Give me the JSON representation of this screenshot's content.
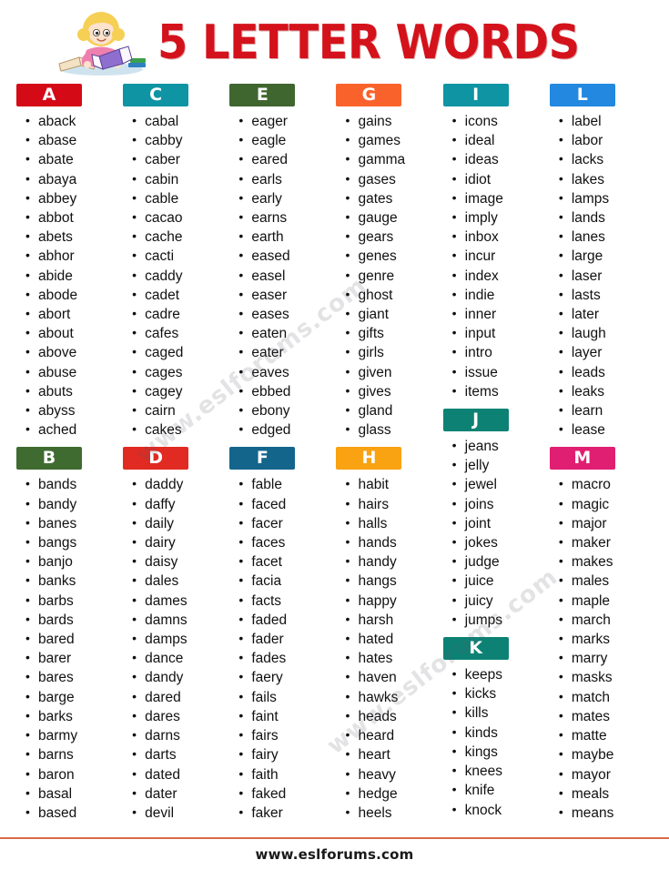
{
  "header": {
    "title": "5 LETTER WORDS",
    "mascot_icon": "girl-reading-book-illustration",
    "title_color": "#d4121b"
  },
  "watermark": {
    "text": "www.eslforums.com"
  },
  "footer": {
    "site": "www.eslforums.com",
    "rule_color": "#d76a4a"
  },
  "columns": [
    {
      "sections": [
        {
          "letter": "A",
          "color": "#d40a16",
          "words": [
            "aback",
            "abase",
            "abate",
            "abaya",
            "abbey",
            "abbot",
            "abets",
            "abhor",
            "abide",
            "abode",
            "abort",
            "about",
            "above",
            "abuse",
            "abuts",
            "abyss",
            "ached"
          ]
        },
        {
          "letter": "B",
          "color": "#3f6b31",
          "words": [
            "bands",
            "bandy",
            "banes",
            "bangs",
            "banjo",
            "banks",
            "barbs",
            "bards",
            "bared",
            "barer",
            "bares",
            "barge",
            "barks",
            "barmy",
            "barns",
            "baron",
            "basal",
            "based"
          ]
        }
      ]
    },
    {
      "sections": [
        {
          "letter": "C",
          "color": "#0f94a3",
          "words": [
            "cabal",
            "cabby",
            "caber",
            "cabin",
            "cable",
            "cacao",
            "cache",
            "cacti",
            "caddy",
            "cadet",
            "cadre",
            "cafes",
            "caged",
            "cages",
            "cagey",
            "cairn",
            "cakes"
          ]
        },
        {
          "letter": "D",
          "color": "#e12a21",
          "words": [
            "daddy",
            "daffy",
            "daily",
            "dairy",
            "daisy",
            "dales",
            "dames",
            "damns",
            "damps",
            "dance",
            "dandy",
            "dared",
            "dares",
            "darns",
            "darts",
            "dated",
            "dater",
            "devil"
          ]
        }
      ]
    },
    {
      "sections": [
        {
          "letter": "E",
          "color": "#40662f",
          "words": [
            "eager",
            "eagle",
            "eared",
            "earls",
            "early",
            "earns",
            "earth",
            "eased",
            "easel",
            "easer",
            "eases",
            "eaten",
            "eater",
            "eaves",
            "ebbed",
            "ebony",
            "edged"
          ]
        },
        {
          "letter": "F",
          "color": "#13658c",
          "words": [
            "fable",
            "faced",
            "facer",
            "faces",
            "facet",
            "facia",
            "facts",
            "faded",
            "fader",
            "fades",
            "faery",
            "fails",
            "faint",
            "fairs",
            "fairy",
            "faith",
            "faked",
            "faker"
          ]
        }
      ]
    },
    {
      "sections": [
        {
          "letter": "G",
          "color": "#f9632b",
          "words": [
            "gains",
            "games",
            "gamma",
            "gases",
            "gates",
            "gauge",
            "gears",
            "genes",
            "genre",
            "ghost",
            "giant",
            "gifts",
            "girls",
            "given",
            "gives",
            "gland",
            "glass"
          ]
        },
        {
          "letter": "H",
          "color": "#f9a212",
          "words": [
            "habit",
            "hairs",
            "halls",
            "hands",
            "handy",
            "hangs",
            "happy",
            "harsh",
            "hated",
            "hates",
            "haven",
            "hawks",
            "heads",
            "heard",
            "heart",
            "heavy",
            "hedge",
            "heels"
          ]
        }
      ]
    },
    {
      "sections": [
        {
          "letter": "I",
          "color": "#0f94a3",
          "words": [
            "icons",
            "ideal",
            "ideas",
            "idiot",
            "image",
            "imply",
            "inbox",
            "incur",
            "index",
            "indie",
            "inner",
            "input",
            "intro",
            "issue",
            "items"
          ]
        },
        {
          "letter": "J",
          "color": "#0d8274",
          "words": [
            "jeans",
            "jelly",
            "jewel",
            "joins",
            "joint",
            "jokes",
            "judge",
            "juice",
            "juicy",
            "jumps"
          ]
        },
        {
          "letter": "K",
          "color": "#0d8274",
          "words": [
            "keeps",
            "kicks",
            "kills",
            "kinds",
            "kings",
            "knees",
            "knife",
            "knock"
          ]
        }
      ]
    },
    {
      "sections": [
        {
          "letter": "L",
          "color": "#2288e0",
          "words": [
            "label",
            "labor",
            "lacks",
            "lakes",
            "lamps",
            "lands",
            "lanes",
            "large",
            "laser",
            "lasts",
            "later",
            "laugh",
            "layer",
            "leads",
            "leaks",
            "learn",
            "lease"
          ]
        },
        {
          "letter": "M",
          "color": "#e01f72",
          "words": [
            "macro",
            "magic",
            "major",
            "maker",
            "makes",
            "males",
            "maple",
            "march",
            "marks",
            "marry",
            "masks",
            "match",
            "mates",
            "matte",
            "maybe",
            "mayor",
            "meals",
            "means"
          ]
        }
      ]
    }
  ]
}
